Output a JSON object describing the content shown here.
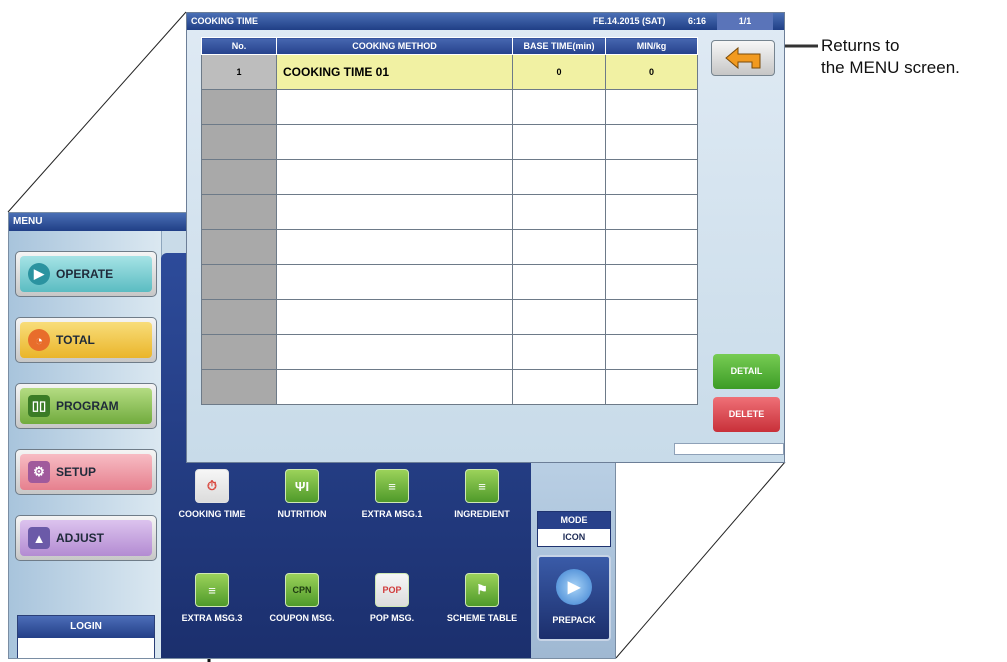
{
  "menu_screen": {
    "title": "MENU",
    "buttons": [
      {
        "label": "OPERATE",
        "color": "#7fd1d6"
      },
      {
        "label": "TOTAL",
        "color": "#f3cf4e"
      },
      {
        "label": "PROGRAM",
        "color": "#92ca5a"
      },
      {
        "label": "SETUP",
        "color": "#f39aa6"
      },
      {
        "label": "ADJUST",
        "color": "#c8a3e0"
      }
    ],
    "login_label": "LOGIN",
    "icons_row1": [
      {
        "label": "COOKING TIME",
        "icon": "stopwatch-icon"
      },
      {
        "label": "NUTRITION",
        "icon": "cutlery-icon"
      },
      {
        "label": "EXTRA MSG.1",
        "icon": "document-icon"
      },
      {
        "label": "INGREDIENT",
        "icon": "document-icon"
      }
    ],
    "icons_row2": [
      {
        "label": "EXTRA MSG.3",
        "icon": "document-icon"
      },
      {
        "label": "COUPON MSG.",
        "icon": "coupon-icon",
        "badge": "CPN"
      },
      {
        "label": "POP MSG.",
        "icon": "pop-icon",
        "badge": "POP"
      },
      {
        "label": "SCHEME TABLE",
        "icon": "scheme-icon"
      }
    ],
    "mode_label": "MODE",
    "mode_value": "ICON",
    "prepack_label": "PREPACK"
  },
  "cooking_screen": {
    "title": "COOKING TIME",
    "date": "FE.14.2015 (SAT)",
    "time": "6:16",
    "page": "1/1",
    "columns": [
      "No.",
      "COOKING METHOD",
      "BASE TIME(min)",
      "MIN/kg"
    ],
    "rows": [
      {
        "no": "1",
        "method": "COOKING TIME 01",
        "base": "0",
        "minkg": "0"
      }
    ],
    "empty_rows": 9,
    "detail_label": "DETAIL",
    "delete_label": "DELETE"
  },
  "annotation": {
    "line1": "Returns to",
    "line2": "the MENU screen."
  },
  "colors": {
    "title_blue": "#203f86",
    "selected_row": "#f1f1a3",
    "detail_green": "#54b034",
    "delete_red": "#d8464f"
  }
}
